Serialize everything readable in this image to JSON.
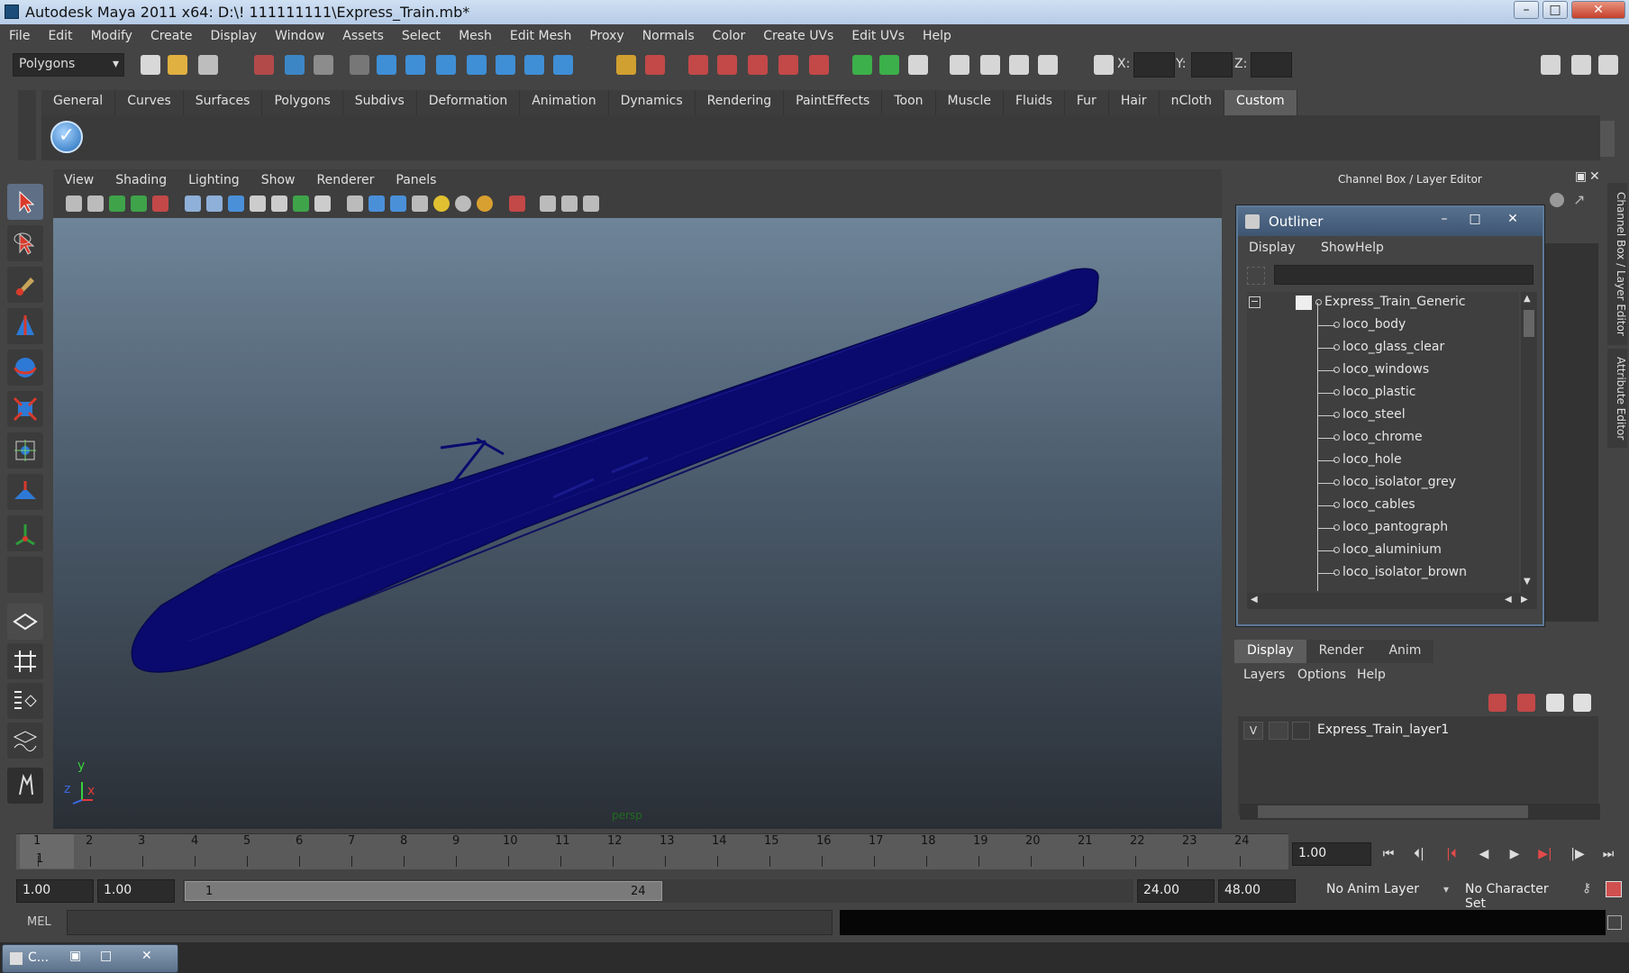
{
  "window": {
    "title": "Autodesk Maya 2011 x64: D:\\! 111111111\\Express_Train.mb*"
  },
  "menubar": [
    "File",
    "Edit",
    "Modify",
    "Create",
    "Display",
    "Window",
    "Assets",
    "Select",
    "Mesh",
    "Edit Mesh",
    "Proxy",
    "Normals",
    "Color",
    "Create UVs",
    "Edit UVs",
    "Help"
  ],
  "statusline": {
    "mode": "Polygons",
    "x_label": "X:",
    "y_label": "Y:",
    "z_label": "Z:"
  },
  "shelf": {
    "tabs": [
      "General",
      "Curves",
      "Surfaces",
      "Polygons",
      "Subdivs",
      "Deformation",
      "Animation",
      "Dynamics",
      "Rendering",
      "PaintEffects",
      "Toon",
      "Muscle",
      "Fluids",
      "Fur",
      "Hair",
      "nCloth",
      "Custom"
    ],
    "active_tab": "Custom"
  },
  "viewport": {
    "menu": [
      "View",
      "Shading",
      "Lighting",
      "Show",
      "Renderer",
      "Panels"
    ],
    "camera_label": "persp",
    "axis_x": "x",
    "axis_y": "y",
    "axis_z": "z",
    "mesh_color": "#0a0a6e"
  },
  "channel_box": {
    "header": "Channel Box / Layer Editor",
    "side_tabs": [
      "Channel Box / Layer Editor",
      "Attribute Editor"
    ]
  },
  "outliner": {
    "title": "Outliner",
    "menu": [
      "Display",
      "Show",
      "Help"
    ],
    "root": "Express_Train_Generic",
    "children": [
      "loco_body",
      "loco_glass_clear",
      "loco_windows",
      "loco_plastic",
      "loco_steel",
      "loco_chrome",
      "loco_hole",
      "loco_isolator_grey",
      "loco_cables",
      "loco_pantograph",
      "loco_aluminium",
      "loco_isolator_brown"
    ]
  },
  "layer_editor": {
    "tabs": [
      "Display",
      "Render",
      "Anim"
    ],
    "active_tab": "Display",
    "menu": [
      "Layers",
      "Options",
      "Help"
    ],
    "layers": [
      {
        "visible": "V",
        "name": "Express_Train_layer1"
      }
    ]
  },
  "timeline": {
    "ticks": [
      "1",
      "2",
      "3",
      "4",
      "5",
      "6",
      "7",
      "8",
      "9",
      "10",
      "11",
      "12",
      "13",
      "14",
      "15",
      "16",
      "17",
      "18",
      "19",
      "20",
      "21",
      "22",
      "23",
      "24"
    ],
    "current_marker": "1",
    "current_frame": "1.00",
    "start_time": "1.00",
    "playback_start": "1.00",
    "range_start": "1",
    "range_end": "24",
    "playback_end": "24.00",
    "end_time": "48.00",
    "anim_layer": "No Anim Layer",
    "character_set": "No Character Set"
  },
  "command_line": {
    "label": "MEL"
  },
  "taskbar": {
    "item": "C..."
  }
}
